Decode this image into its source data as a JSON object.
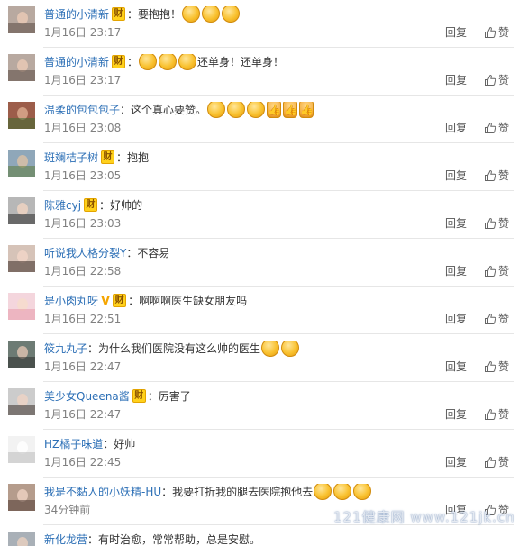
{
  "labels": {
    "reply": "回复",
    "like": "赞",
    "member_badge": "财"
  },
  "comments": [
    {
      "username": "普通的小清新",
      "badge": true,
      "content_before": "要抱抱！",
      "emojis": [
        "angry",
        "angry",
        "angry"
      ],
      "content_after": "",
      "time": "1月16日 23:17"
    },
    {
      "username": "普通的小清新",
      "badge": true,
      "content_before": "",
      "emojis": [
        "angry",
        "angry",
        "angry"
      ],
      "content_after": "还单身！还单身！",
      "time": "1月16日 23:17"
    },
    {
      "username": "温柔的包包包子",
      "badge": false,
      "content_before": "这个真心要赞。",
      "emojis": [
        "grin",
        "grin",
        "grin",
        "thumb",
        "thumb",
        "thumb"
      ],
      "content_after": "",
      "time": "1月16日 23:08"
    },
    {
      "username": "斑斓桔子树",
      "badge": true,
      "content_before": "抱抱",
      "emojis": [],
      "content_after": "",
      "time": "1月16日 23:05"
    },
    {
      "username": "陈雅cyj",
      "badge": true,
      "content_before": "好帅的",
      "emojis": [],
      "content_after": "",
      "time": "1月16日 23:03"
    },
    {
      "username": "听说我人格分裂Y",
      "badge": false,
      "content_before": "不容易",
      "emojis": [],
      "content_after": "",
      "time": "1月16日 22:58"
    },
    {
      "username": "是小肉丸呀",
      "badge": true,
      "verified": true,
      "content_before": "啊啊啊医生缺女朋友吗",
      "emojis": [],
      "content_after": "",
      "time": "1月16日 22:51"
    },
    {
      "username": "筱九丸子",
      "badge": false,
      "content_before": "为什么我们医院没有这么帅的医生",
      "emojis": [
        "cry",
        "cry"
      ],
      "content_after": "",
      "time": "1月16日 22:47"
    },
    {
      "username": "美少女Queena酱",
      "badge": true,
      "content_before": "厉害了",
      "emojis": [],
      "content_after": "",
      "time": "1月16日 22:47"
    },
    {
      "username": "HZ橘子味道",
      "badge": false,
      "content_before": "好帅",
      "emojis": [],
      "content_after": "",
      "time": "1月16日 22:45"
    },
    {
      "username": "我是不黏人的小妖精-HU",
      "badge": false,
      "content_before": "我要打折我的腿去医院抱他去",
      "emojis": [
        "laugh",
        "laugh",
        "laugh"
      ],
      "content_after": "",
      "time": "34分钟前"
    },
    {
      "username": "新化龙营",
      "badge": false,
      "content_before": "有时治愈，常常帮助，总是安慰。",
      "emojis": [],
      "content_after": "",
      "time": ""
    }
  ],
  "avatars": [
    {
      "bg": "#b8a9a0",
      "accent": "#5a4a44",
      "face": "#e8c9b5"
    },
    {
      "bg": "#b8a9a0",
      "accent": "#5a4a44",
      "face": "#e8c9b5"
    },
    {
      "bg": "#9c5d4a",
      "accent": "#3d6b2f",
      "face": "#d9a88c"
    },
    {
      "bg": "#8fa7b9",
      "accent": "#5e7c3d",
      "face": "#d8c0a6"
    },
    {
      "bg": "#b7b7b7",
      "accent": "#2a2a2a",
      "face": "#efd3c2"
    },
    {
      "bg": "#d6c3b8",
      "accent": "#3a2a25",
      "face": "#f1d5c7"
    },
    {
      "bg": "#f4d6dd",
      "accent": "#e79aa9",
      "face": "#f6dccd"
    },
    {
      "bg": "#6d7b74",
      "accent": "#2e302d",
      "face": "#d9bfae"
    },
    {
      "bg": "#cccccc",
      "accent": "#3b2f2a",
      "face": "#ecd2c4"
    },
    {
      "bg": "#f2f2f2",
      "accent": "#bbbbbb",
      "face": "#ffffff"
    },
    {
      "bg": "#b59c8c",
      "accent": "#4f3b33",
      "face": "#ecd0bf"
    },
    {
      "bg": "#a9b0b7",
      "accent": "#55606a",
      "face": "#e6cfc0"
    }
  ],
  "watermark": "121健康网 www.121jk.cn",
  "colors": {
    "username": "#2c6fb6",
    "badge": "#ffd11c",
    "meta": "#808080",
    "divider": "#e6e6e6",
    "verified": "#f5a500"
  }
}
